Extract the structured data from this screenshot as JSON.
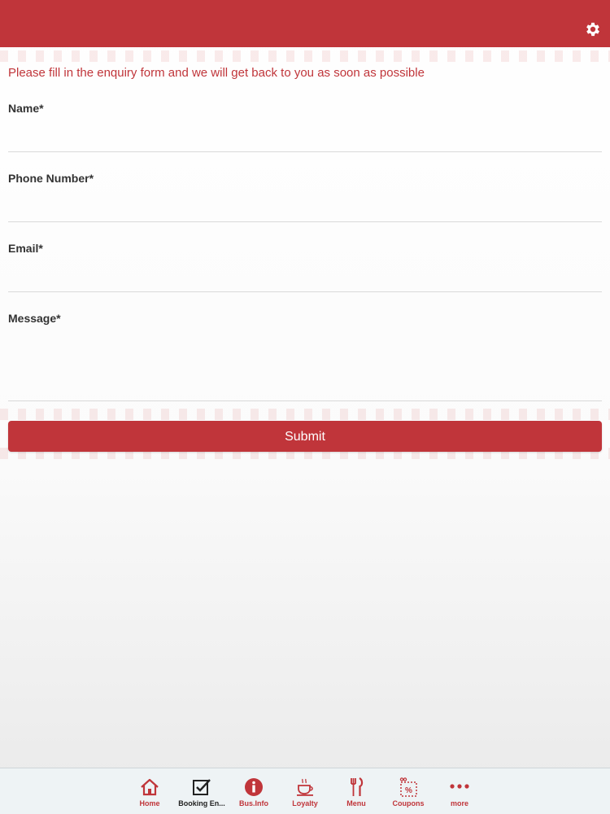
{
  "header": {
    "background_color": "#c0353a",
    "settings_icon": "gear-icon"
  },
  "form": {
    "intro_text": "Please fill in the enquiry form and we will get back to you as soon as possible",
    "fields": [
      {
        "label": "Name*",
        "value": "",
        "placeholder": ""
      },
      {
        "label": "Phone Number*",
        "value": "",
        "placeholder": ""
      },
      {
        "label": "Email*",
        "value": "",
        "placeholder": ""
      },
      {
        "label": "Message*",
        "value": "",
        "placeholder": ""
      }
    ],
    "submit_label": "Submit"
  },
  "tabbar": {
    "items": [
      {
        "label": "Home",
        "icon": "home-icon"
      },
      {
        "label": "Booking En...",
        "icon": "checkbox-icon"
      },
      {
        "label": "Bus.Info",
        "icon": "info-icon"
      },
      {
        "label": "Loyalty",
        "icon": "coffee-cup-icon"
      },
      {
        "label": "Menu",
        "icon": "fork-knife-icon"
      },
      {
        "label": "Coupons",
        "icon": "coupon-icon"
      },
      {
        "label": "more",
        "icon": "more-dots-icon"
      }
    ]
  },
  "colors": {
    "accent": "#c0353a",
    "label_text": "#333333",
    "tabbar_bg": "#eef3f5"
  }
}
